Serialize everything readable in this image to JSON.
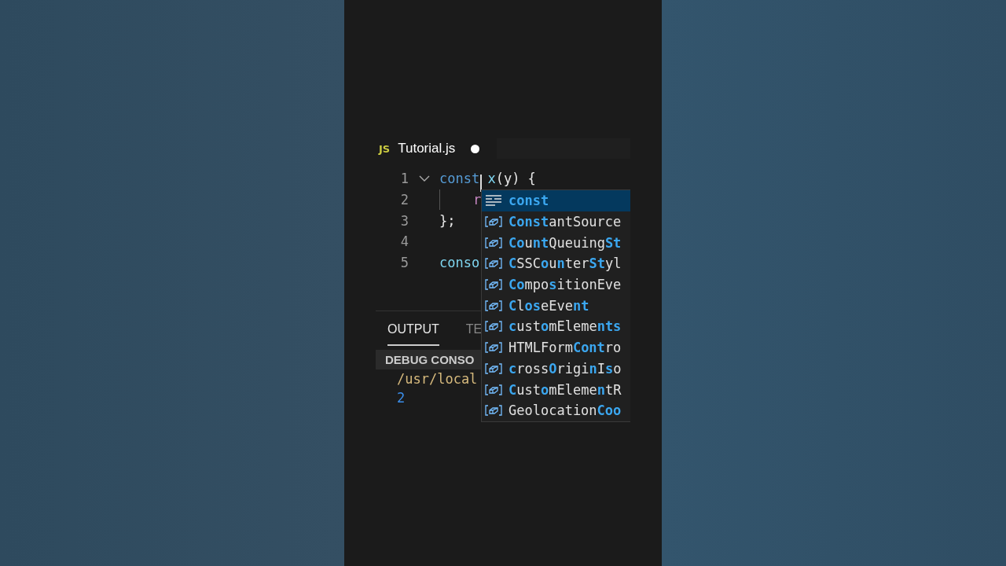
{
  "tab": {
    "language": "JS",
    "title": "Tutorial.js",
    "modified": true
  },
  "code_lines": [
    {
      "number": "1",
      "foldable": true,
      "tokens": [
        {
          "text": "const",
          "kind": "keyword"
        },
        {
          "text": " x",
          "kind": "name"
        },
        {
          "text": "(y) {",
          "kind": "plain"
        }
      ]
    },
    {
      "number": "2",
      "foldable": false,
      "indent": true,
      "tokens": [
        {
          "text": "r",
          "kind": "control"
        }
      ]
    },
    {
      "number": "3",
      "foldable": false,
      "tokens": [
        {
          "text": "};",
          "kind": "plain"
        }
      ]
    },
    {
      "number": "4",
      "foldable": false
    },
    {
      "number": "5",
      "foldable": false,
      "tokens": [
        {
          "text": "conso",
          "kind": "name"
        }
      ]
    }
  ],
  "suggestions": [
    {
      "label": "**const**",
      "kind": "keyword",
      "selected": true
    },
    {
      "label": "**Const**antSource",
      "kind": "variable",
      "selected": false
    },
    {
      "label": "**Co**u**nt**Queuing**St**",
      "kind": "variable",
      "selected": false
    },
    {
      "label": "**C**SSC**o**u**n**ter**St**yl",
      "kind": "variable",
      "selected": false
    },
    {
      "label": "**Co**mpo**s**itionEve",
      "kind": "variable",
      "selected": false
    },
    {
      "label": "**C**l**os**eEve**nt**",
      "kind": "variable",
      "selected": false
    },
    {
      "label": "**c**ust**o**mEleme**nts**",
      "kind": "variable",
      "selected": false
    },
    {
      "label": "HTMLForm**Cont**ro",
      "kind": "variable",
      "selected": false
    },
    {
      "label": "**c**ross**O**rigi**n**I**s**o",
      "kind": "variable",
      "selected": false
    },
    {
      "label": "**C**ust**o**mEleme**n**tR",
      "kind": "variable",
      "selected": false
    },
    {
      "label": "Geolocation**Coo**",
      "kind": "variable",
      "selected": false
    }
  ],
  "panel_tabs": [
    {
      "label": "OUTPUT",
      "selected": true
    },
    {
      "label": "TE",
      "selected": false
    }
  ],
  "debug_console": {
    "title": "DEBUG CONSO",
    "lines": [
      {
        "text": "/usr/local",
        "kind": "path"
      },
      {
        "text": "2",
        "kind": "number"
      }
    ]
  }
}
